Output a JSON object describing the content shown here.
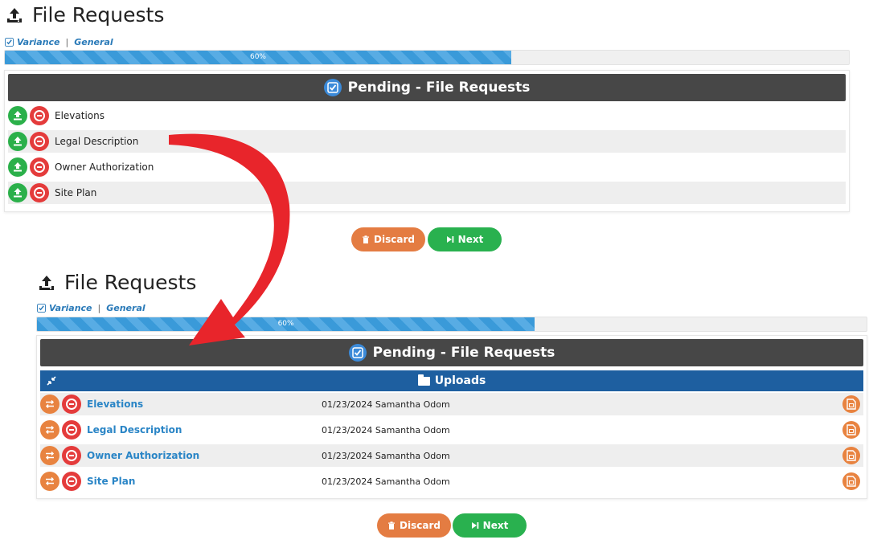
{
  "top": {
    "title": "File Requests",
    "breadcrumb": {
      "first": "Variance",
      "sep": "|",
      "second": "General"
    },
    "progress": {
      "label": "60%",
      "value": 0.6
    },
    "panel_title": "Pending - File Requests",
    "rows": [
      {
        "label": "Elevations"
      },
      {
        "label": "Legal Description"
      },
      {
        "label": "Owner Authorization"
      },
      {
        "label": "Site Plan"
      }
    ],
    "discard_label": "Discard",
    "next_label": "Next"
  },
  "bottom": {
    "title": "File Requests",
    "breadcrumb": {
      "first": "Variance",
      "sep": "|",
      "second": "General"
    },
    "progress": {
      "label": "60%",
      "value": 0.6
    },
    "panel_title": "Pending - File Requests",
    "uploads_label": "Uploads",
    "rows": [
      {
        "label": "Elevations",
        "info": "01/23/2024 Samantha Odom"
      },
      {
        "label": "Legal Description",
        "info": "01/23/2024 Samantha Odom"
      },
      {
        "label": "Owner Authorization",
        "info": "01/23/2024 Samantha Odom"
      },
      {
        "label": "Site Plan",
        "info": "01/23/2024 Samantha Odom"
      }
    ],
    "discard_label": "Discard",
    "next_label": "Next"
  },
  "colors": {
    "arrow": "#e8252b",
    "green": "#2bb04a",
    "red": "#e43b3b",
    "orange": "#e88340",
    "uploads_bar": "#1e5fa0",
    "panel_head": "#474747"
  },
  "icons": {
    "title": "upload-tray-icon",
    "upload": "upload-icon",
    "remove": "remove-circle-icon",
    "replace": "swap-arrows-icon",
    "file": "pdf-file-icon",
    "collapse": "compress-icon",
    "folder": "folder-icon"
  }
}
